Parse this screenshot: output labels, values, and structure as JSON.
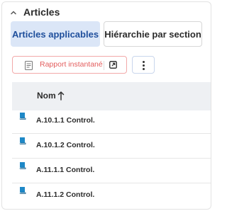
{
  "section": {
    "title": "Articles"
  },
  "tabs": [
    {
      "label": "Articles applicables",
      "active": true
    },
    {
      "label": "Hiérarchie par section",
      "active": false
    }
  ],
  "toolbar": {
    "report_label": "Rapport instantané"
  },
  "table": {
    "columns": [
      {
        "label": "Nom",
        "sort": "ascending"
      }
    ],
    "rows": [
      {
        "name": "A.10.1.1 Control."
      },
      {
        "name": "A.10.1.2 Control."
      },
      {
        "name": "A.11.1.1 Control."
      },
      {
        "name": "A.11.1.2 Control."
      }
    ]
  },
  "colors": {
    "accent": "#1f4f9c",
    "tab_active_bg": "#dbe6f7",
    "report_red": "#e35d5d",
    "book_blue": "#1e88c7"
  },
  "icons": {
    "collapse": "chevron-up-icon",
    "report": "document-icon",
    "open": "external-link-icon",
    "more": "more-vertical-icon",
    "sort": "arrow-up-icon",
    "row": "book-icon"
  }
}
